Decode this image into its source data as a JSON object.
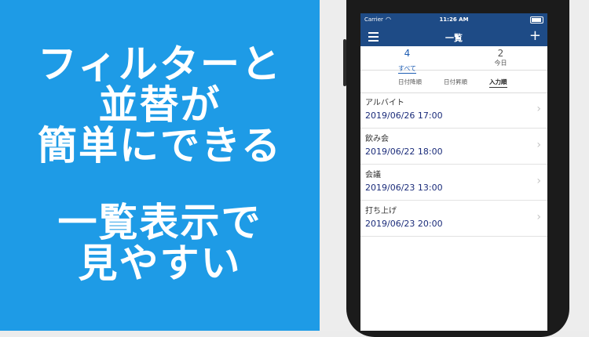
{
  "promo": {
    "lines": [
      "フィルターと",
      "並替が",
      "簡単にできる",
      "一覧表示で",
      "見やすい"
    ]
  },
  "status_bar": {
    "carrier": "Carrier",
    "time": "11:26 AM"
  },
  "navbar": {
    "title": "一覧",
    "add_label": "+"
  },
  "filters": [
    {
      "count": "4",
      "label": "すべて",
      "active": true
    },
    {
      "count": "2",
      "label": "今日",
      "active": false
    }
  ],
  "sorts": [
    {
      "label": "日付降順"
    },
    {
      "label": "日付昇順"
    },
    {
      "label": "入力順",
      "active": true
    }
  ],
  "events": [
    {
      "title": "アルバイト",
      "date": "2019/06/26 17:00"
    },
    {
      "title": "飲み会",
      "date": "2019/06/22 18:00"
    },
    {
      "title": "会議",
      "date": "2019/06/23 13:00"
    },
    {
      "title": "打ち上げ",
      "date": "2019/06/23 20:00"
    }
  ],
  "colors": {
    "promo_bg": "#1e9be6",
    "navbar_bg": "#1e4b86",
    "accent": "#1e5db3",
    "date_text": "#1b2c7a"
  }
}
